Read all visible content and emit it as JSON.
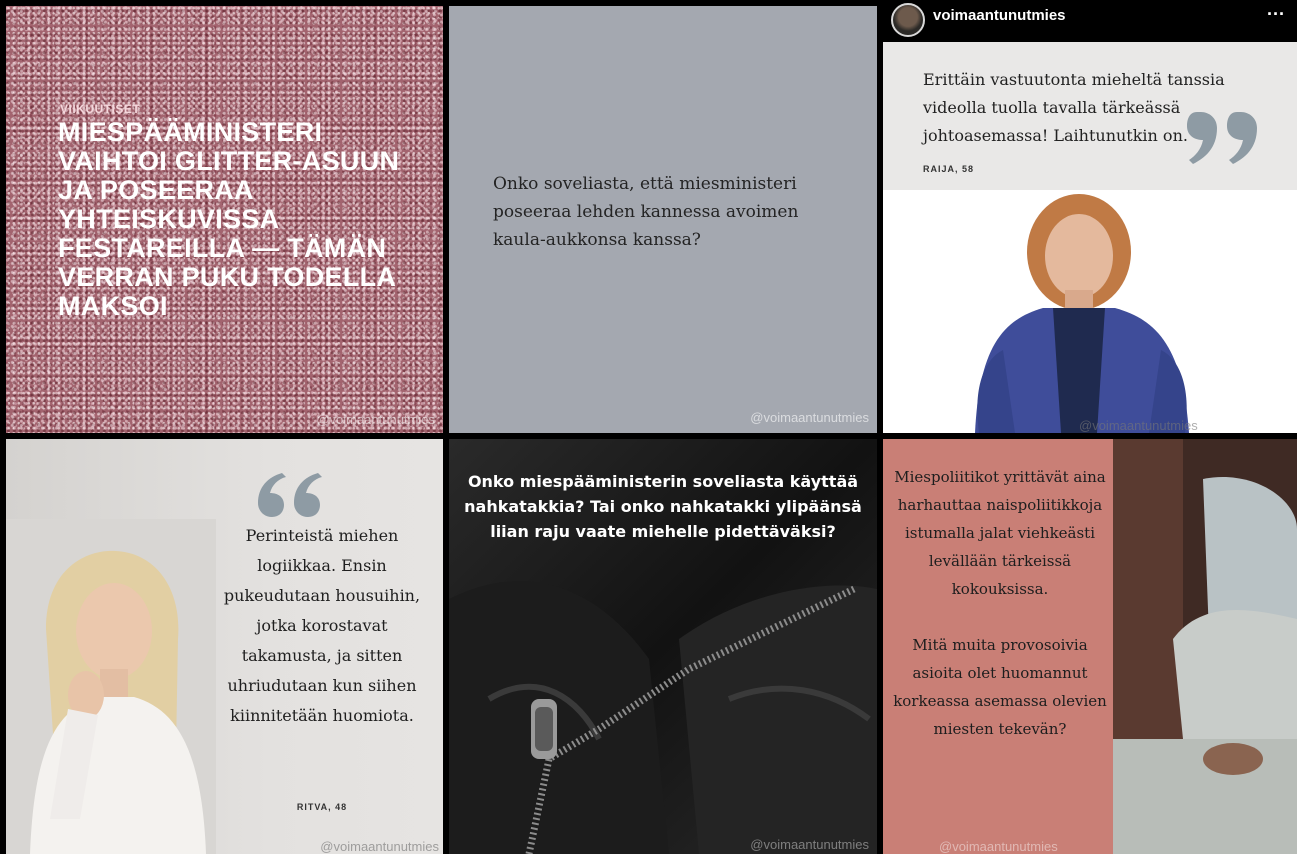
{
  "tiles": {
    "t1": {
      "label": "VIIKUUTISET",
      "headline": "MIESPÄÄMINISTERI VAIHTOI GLITTER-ASUUN JA POSEERAA YHTEISKUVISSA FESTAREILLA — TÄMÄN VERRAN PUKU TODELLA MAKSOI",
      "watermark": "@voimaantunutmies"
    },
    "t2": {
      "question": "Onko soveliasta, että miesministeri poseeraa lehden kannessa avoimen kaula-aukkonsa kanssa?",
      "watermark": "@voimaantunutmies"
    },
    "t3": {
      "username": "voimaantunutmies",
      "more": "···",
      "quote": "Erittäin vastuutonta mieheltä tanssia videolla tuolla tavalla tärkeässä johtoasemassa! Laihtunutkin on.",
      "author": "RAIJA, 58",
      "watermark": "@voimaantunutmies"
    },
    "t4": {
      "quote": "Perinteistä miehen logiikkaa. Ensin pukeudutaan housuihin, jotka korostavat takamusta, ja sitten uhriudutaan kun siihen kiinnitetään huomiota.",
      "author": "RITVA, 48",
      "watermark": "@voimaantunutmies"
    },
    "t5": {
      "headline": "Onko miespääministerin soveliasta käyttää nahkatakkia? Tai onko nahkatakki ylipäänsä liian raju vaate miehelle pidettäväksi?",
      "watermark": "@voimaantunutmies"
    },
    "t6": {
      "para1": "Miespoliitikot yrittävät aina harhauttaa naispoliitikkoja istumalla jalat viehkeästi levällään tärkeissä kokouksissa.",
      "para2": "Mitä muita provosoivia asioita olet huomannut korkeassa asemassa olevien miesten tekevän?",
      "watermark": "@voimaantunutmies"
    }
  },
  "colors": {
    "glitter": "#a3646f",
    "gray_panel": "#a4a8b0",
    "quote_gray": "#7a7a7a",
    "salmon_panel": "#c97f76",
    "quote_icon": "#8e9ba4"
  }
}
